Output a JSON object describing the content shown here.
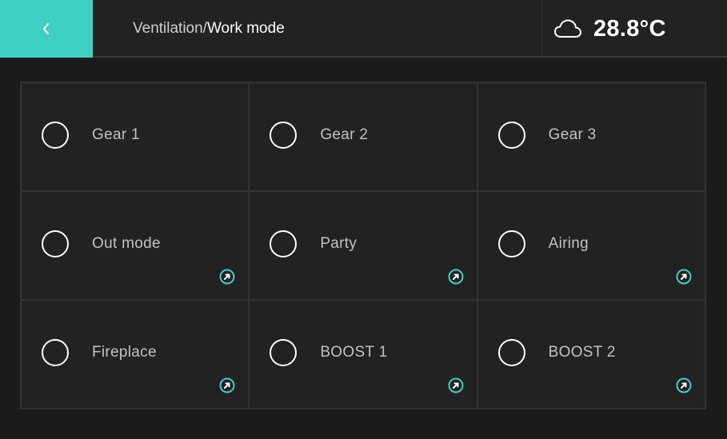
{
  "header": {
    "back_icon": "chevron-left-icon",
    "breadcrumb_parent": "Ventilation/",
    "breadcrumb_current": "Work mode",
    "weather_icon": "cloud-icon",
    "temperature": "28.8°C"
  },
  "colors": {
    "accent": "#3fd0c4",
    "background": "#1b1b1b",
    "tile": "#222222",
    "border": "#333333"
  },
  "modes": [
    {
      "label": "Gear 1",
      "selected": false,
      "has_link": false
    },
    {
      "label": "Gear 2",
      "selected": false,
      "has_link": false
    },
    {
      "label": "Gear 3",
      "selected": false,
      "has_link": false
    },
    {
      "label": "Out mode",
      "selected": false,
      "has_link": true,
      "link_icon": "arrow-up-right-circle-icon"
    },
    {
      "label": "Party",
      "selected": false,
      "has_link": true,
      "link_icon": "arrow-up-right-circle-icon"
    },
    {
      "label": "Airing",
      "selected": false,
      "has_link": true,
      "link_icon": "arrow-up-right-circle-icon"
    },
    {
      "label": "Fireplace",
      "selected": false,
      "has_link": true,
      "link_icon": "arrow-up-right-circle-icon"
    },
    {
      "label": "BOOST 1",
      "selected": false,
      "has_link": true,
      "link_icon": "arrow-up-right-circle-icon"
    },
    {
      "label": "BOOST 2",
      "selected": false,
      "has_link": true,
      "link_icon": "arrow-up-right-circle-icon"
    }
  ]
}
